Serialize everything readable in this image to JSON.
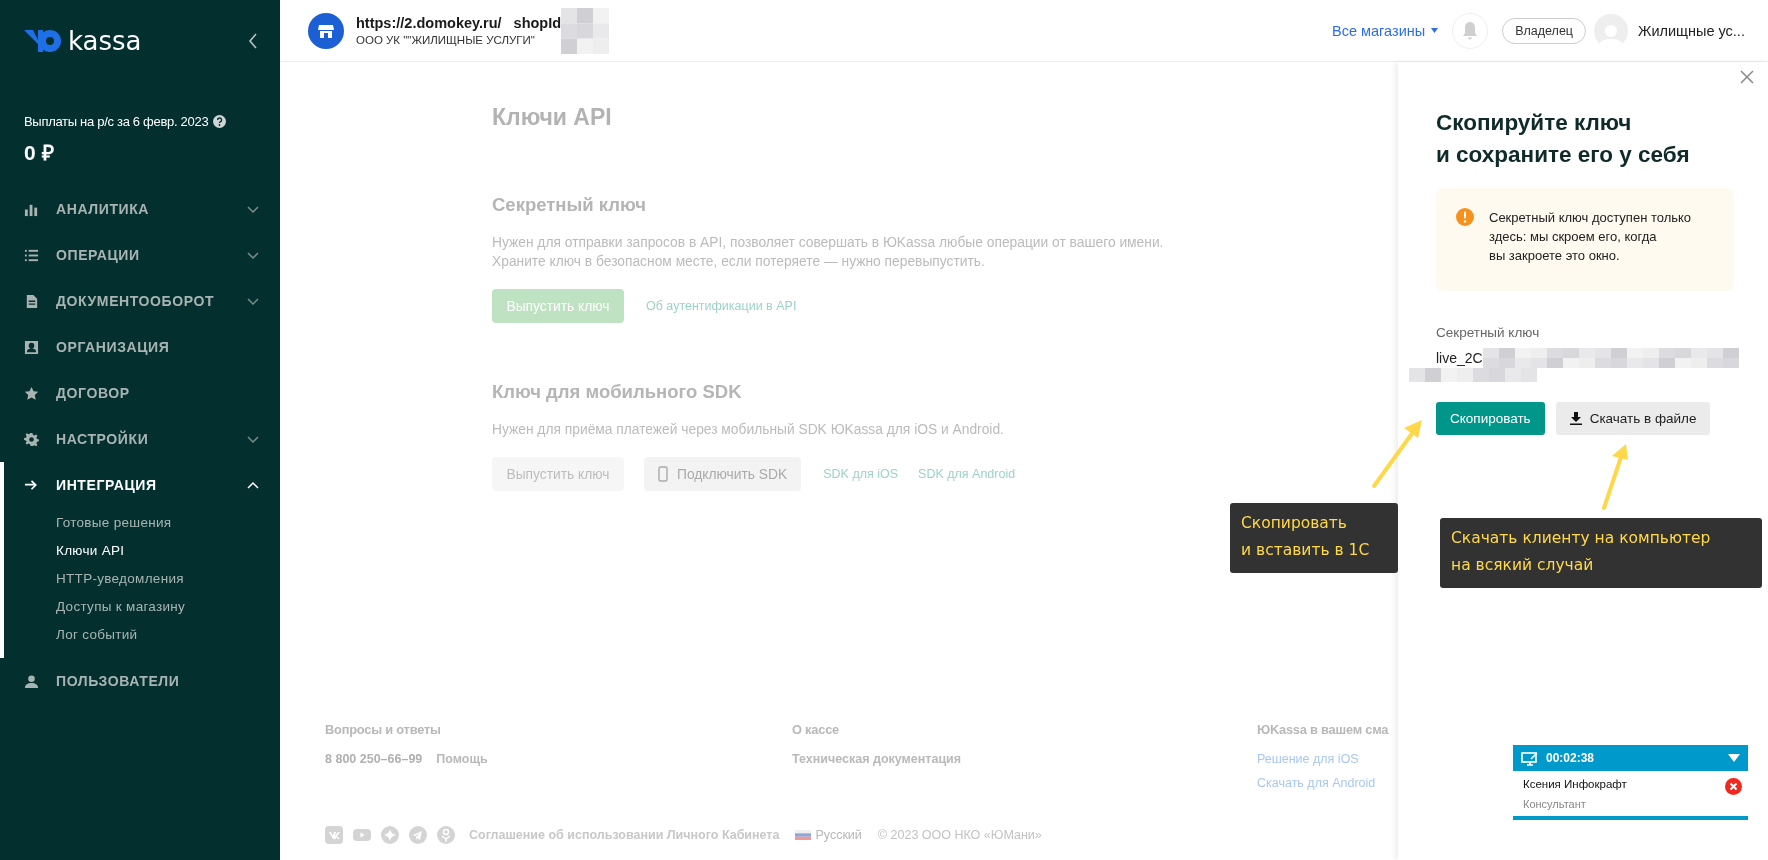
{
  "sidebar": {
    "logo": "kassa",
    "payout_label": "Выплаты на р/с за 6 февр. 2023",
    "payout_amount": "0 ₽",
    "nav": [
      {
        "label": "АНАЛИТИКА",
        "kind": "group",
        "expanded": false,
        "selected": false
      },
      {
        "label": "ОПЕРАЦИИ",
        "kind": "group",
        "expanded": false,
        "selected": false
      },
      {
        "label": "ДОКУМЕНТООБОРОТ",
        "kind": "group",
        "expanded": false,
        "selected": false
      },
      {
        "label": "ОРГАНИЗАЦИЯ",
        "kind": "link",
        "selected": false
      },
      {
        "label": "ДОГОВОР",
        "kind": "link",
        "selected": false
      },
      {
        "label": "НАСТРОЙКИ",
        "kind": "group",
        "expanded": false,
        "selected": false
      },
      {
        "label": "ИНТЕГРАЦИЯ",
        "kind": "group",
        "expanded": true,
        "selected": true,
        "children": [
          {
            "label": "Готовые решения",
            "selected": false
          },
          {
            "label": "Ключи API",
            "selected": true
          },
          {
            "label": "HTTP-уведомления",
            "selected": false
          },
          {
            "label": "Доступы к магазину",
            "selected": false
          },
          {
            "label": "Лог событий",
            "selected": false
          }
        ]
      },
      {
        "label": "ПОЛЬЗОВАТЕЛИ",
        "kind": "link",
        "selected": false
      }
    ]
  },
  "header": {
    "url": "https://2.domokey.ru/",
    "shop_id_label": "shopId",
    "organization": "ООО УК \"\"ЖИЛИЩНЫЕ УСЛУГИ\"",
    "stores_menu": "Все магазины",
    "role": "Владелец",
    "user": "Жилищные ус..."
  },
  "page": {
    "title": "Ключи API",
    "sections": [
      {
        "title": "Секретный ключ",
        "description": [
          "Нужен для отправки запросов в API, позволяет совершать в ЮKassa любые операции от вашего имени.",
          "Храните ключ в безопасном месте, если потеряете — нужно перевыпустить."
        ],
        "actions": [
          {
            "kind": "primary",
            "label": "Выпустить ключ"
          },
          {
            "kind": "link",
            "label": "Об аутентификации в API"
          }
        ]
      },
      {
        "title": "Ключ для мобильного SDK",
        "description": [
          "Нужен для приёма платежей через мобильный SDK ЮKassa для iOS и Android."
        ],
        "actions": [
          {
            "kind": "disabled",
            "label": "Выпустить ключ"
          },
          {
            "kind": "secondary",
            "label": "Подключить SDK"
          },
          {
            "kind": "link",
            "label": "SDK для iOS"
          },
          {
            "kind": "link",
            "label": "SDK для Android"
          }
        ]
      }
    ]
  },
  "footer": {
    "columns": [
      {
        "title": "Вопросы и ответы",
        "items": [
          {
            "kind": "phone",
            "label": "8 800 250–66–99"
          },
          {
            "kind": "text",
            "label": "Помощь"
          }
        ]
      },
      {
        "title": "О кассе",
        "items": [
          {
            "kind": "text",
            "label": "Техническая документация"
          }
        ]
      },
      {
        "title": "ЮKassa в вашем сма",
        "items": [
          {
            "kind": "link",
            "label": "Решение для iOS"
          },
          {
            "kind": "link",
            "label": "Скачать для Android"
          }
        ]
      }
    ],
    "agreement": "Соглашение об использовании Личного Кабинета",
    "language": "Русский",
    "copyright": "© 2023 ООО НКО «ЮМани»"
  },
  "key_panel": {
    "title": [
      "Скопируйте ключ",
      "и сохраните его у себя"
    ],
    "warning": [
      "Секретный ключ доступен только",
      "здесь: мы скроем его, когда",
      "вы закроете это окно."
    ],
    "key_label": "Секретный ключ",
    "key_value": "live_2C",
    "copy_button": "Скопировать",
    "download_button": "Скачать в файле"
  },
  "annotations": [
    {
      "lines": [
        "Скопировать",
        "и вставить в 1С"
      ]
    },
    {
      "lines": [
        "Скачать клиенту на компьютер",
        "на всякий случай"
      ]
    }
  ],
  "chat_widget": {
    "timer": "00:02:38",
    "name": "Ксения Инфокрафт",
    "role": "Консультант"
  }
}
